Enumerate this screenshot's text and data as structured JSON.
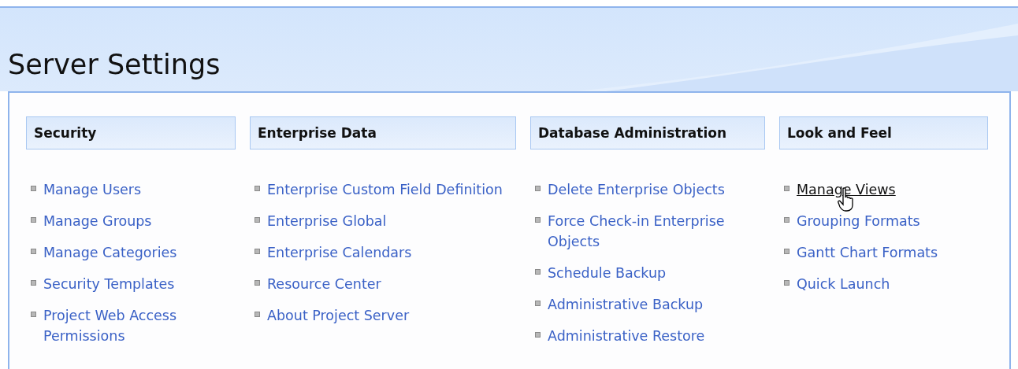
{
  "title": "Server Settings",
  "sections": [
    {
      "heading": "Security",
      "links": [
        {
          "label": "Manage Users",
          "hovered": false
        },
        {
          "label": "Manage Groups",
          "hovered": false
        },
        {
          "label": "Manage Categories",
          "hovered": false
        },
        {
          "label": "Security Templates",
          "hovered": false
        },
        {
          "label": "Project Web Access Permissions",
          "hovered": false
        }
      ]
    },
    {
      "heading": "Enterprise Data",
      "links": [
        {
          "label": "Enterprise Custom Field Definition",
          "hovered": false
        },
        {
          "label": "Enterprise Global",
          "hovered": false
        },
        {
          "label": "Enterprise Calendars",
          "hovered": false
        },
        {
          "label": "Resource Center",
          "hovered": false
        },
        {
          "label": "About Project Server",
          "hovered": false
        }
      ]
    },
    {
      "heading": "Database Administration",
      "links": [
        {
          "label": "Delete Enterprise Objects",
          "hovered": false
        },
        {
          "label": "Force Check-in Enterprise Objects",
          "hovered": false
        },
        {
          "label": "Schedule Backup",
          "hovered": false
        },
        {
          "label": "Administrative Backup",
          "hovered": false
        },
        {
          "label": "Administrative Restore",
          "hovered": false
        }
      ]
    },
    {
      "heading": "Look and Feel",
      "links": [
        {
          "label": "Manage Views",
          "hovered": true
        },
        {
          "label": "Grouping Formats",
          "hovered": false
        },
        {
          "label": "Gantt Chart Formats",
          "hovered": false
        },
        {
          "label": "Quick Launch",
          "hovered": false
        }
      ]
    }
  ]
}
